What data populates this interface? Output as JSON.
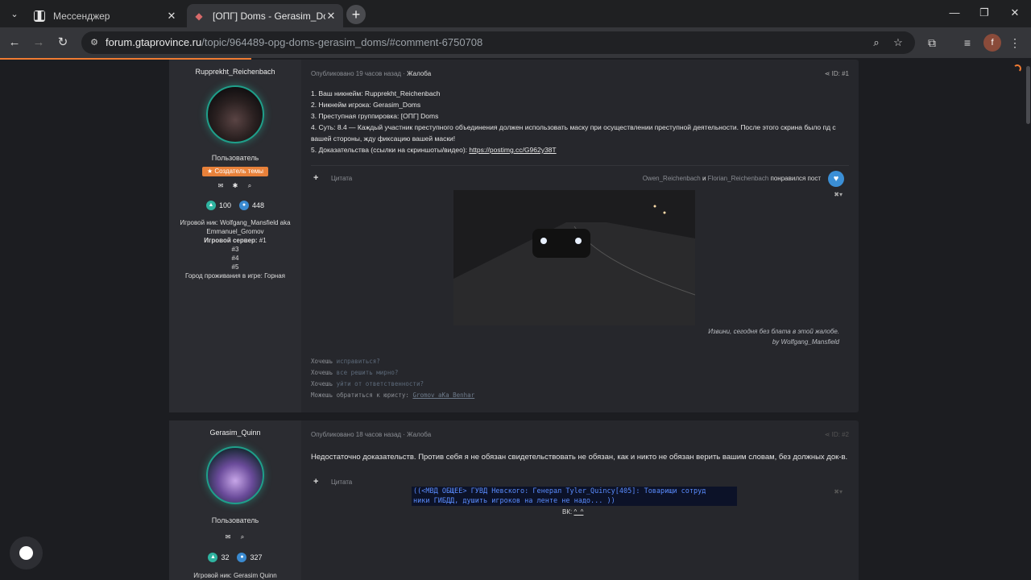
{
  "browser": {
    "tabs": [
      {
        "title": "Мессенджер",
        "icon": "pause-icon"
      },
      {
        "title": "[ОПГ] Doms - Gerasim_Doms -",
        "icon": "car-icon",
        "active": true
      }
    ],
    "url_host": "forum.gtaprovince.ru",
    "url_path": "/topic/964489-opg-doms-gerasim_doms/#comment-6750708",
    "profile_letter": "f"
  },
  "post1": {
    "author": "Rupprekht_Reichenbach",
    "role": "Пользователь",
    "badge": "★ Создатель темы",
    "likes": "100",
    "comments": "448",
    "info": {
      "game_nick": "Игровой ник: Wolfgang_Mansfield aka Emmanuel_Gromov",
      "server_label": "Игровой сервер:",
      "server_value": " #1",
      "s3": "#3",
      "s4": "#4",
      "s5": "#5",
      "city": "Город проживания в игре: Горная"
    },
    "meta_time": "Опубликовано 19 часов назад · ",
    "meta_report": "Жалоба",
    "post_id": "ID: #1",
    "lines": [
      "1. Ваш никнейм: Rupprekht_Reichenbach",
      "2. Никнейм игрока: Gerasim_Doms",
      "3. Преступная группировка: [ОПГ] Doms",
      "4. Суть: 8.4 — Каждый участник преступного объединения должен использовать маску при осуществлении преступной деятельности. После этого скрина было пд с вашей стороны, жду фиксацию вашей маски!",
      "5. Доказательства (ссылки на скриншоты/видео): "
    ],
    "link": "https://postimg.cc/G962y38T",
    "quote": "Цитата",
    "liker1": "Owen_Reichenbach",
    "and": " и ",
    "liker2": "Florian_Reichenbach",
    "liked": " понравился пост",
    "caption1": "Извини, сегодня без блата в этой жалобе.",
    "caption2": "by Wolfgang_Mansfield",
    "sig": [
      {
        "a": "Хочешь ",
        "b": "исправиться?"
      },
      {
        "a": "Хочешь ",
        "b": "все решить мирно?"
      },
      {
        "a": "Хочешь ",
        "b": "уйти от ответственности?"
      }
    ],
    "sig4_a": "Можешь обратиться к юристу: ",
    "sig4_b": "Gromov aKa Benhar"
  },
  "post2": {
    "author": "Gerasim_Quinn",
    "role": "Пользователь",
    "likes": "32",
    "comments": "327",
    "game_nick": "Игровой ник: Gerasim Quinn",
    "meta_time": "Опубликовано 18 часов назад · ",
    "meta_report": "Жалоба",
    "post_id": "ID: #2",
    "text": "Недостаточно доказательств. Против себя я не обязан свидетельствовать не обязан, как и никто не обязан верить вашим словам, без должных док-в.",
    "quote": "Цитата",
    "chat1": "((<МВД ОБЩЕЕ> ГУВД Невского: Генерал Tyler_Quincy[405]: Товарищи сотруд",
    "chat2": "ники ГИБДД, душить игроков на ленте не надо... ))",
    "vk_label": "ВК: ",
    "vk_link": "^_^"
  }
}
